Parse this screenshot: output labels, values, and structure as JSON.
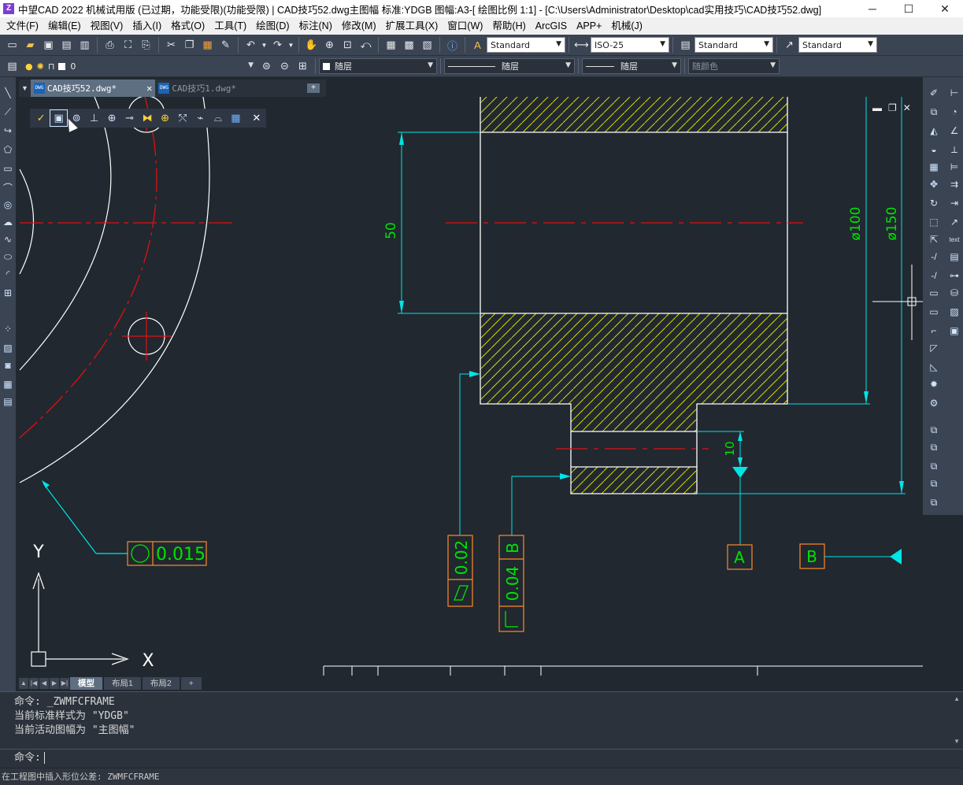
{
  "titlebar": {
    "title": "中望CAD 2022 机械试用版 (已过期，功能受限)(功能受限) | CAD技巧52.dwg主图幅  标准:YDGB  图幅:A3-[ 绘图比例 1:1] - [C:\\Users\\Administrator\\Desktop\\cad实用技巧\\CAD技巧52.dwg]",
    "minimize": "─",
    "maximize": "☐",
    "close": "✕"
  },
  "menubar": {
    "items": [
      "文件(F)",
      "编辑(E)",
      "视图(V)",
      "插入(I)",
      "格式(O)",
      "工具(T)",
      "绘图(D)",
      "标注(N)",
      "修改(M)",
      "扩展工具(X)",
      "窗口(W)",
      "帮助(H)",
      "ArcGIS",
      "APP+",
      "机械(J)"
    ]
  },
  "toolbar1": {
    "text_style": "Standard",
    "dim_style": "ISO-25",
    "table_style": "Standard",
    "mleader_style": "Standard"
  },
  "toolbar2": {
    "layer": "0",
    "color": "随层",
    "linetype": "随层",
    "lineweight": "随层",
    "plotstyle": "随颜色"
  },
  "doctabs": {
    "tabs": [
      {
        "label": "CAD技巧52.dwg*",
        "active": true
      },
      {
        "label": "CAD技巧1.dwg*",
        "active": false
      }
    ],
    "badge": "DWG"
  },
  "layout_tabs": [
    "模型",
    "布局1",
    "布局2",
    "+"
  ],
  "drawing": {
    "dim_50": "50",
    "dim_10": "10",
    "dim_100": "ø100",
    "dim_150": "ø150",
    "datum_a": "A",
    "datum_b": "B",
    "fcf_circularity_value": "0.015",
    "fcf_flatness_value": "0.02",
    "fcf_perp_value": "0.04",
    "fcf_perp_datum": "B",
    "ucs_x": "X",
    "ucs_y": "Y"
  },
  "command": {
    "history": [
      "命令: _ZWMFCFRAME",
      "当前标准样式为 \"YDGB\"",
      "当前活动图幅为 \"主图幅\""
    ],
    "prompt": "命令:"
  },
  "statusbar": {
    "text": "在工程图中插入形位公差:   ZWMFCFRAME"
  },
  "colors": {
    "canvas_bg": "#212830",
    "dim_color": "#00e5e5",
    "text_green": "#00e400",
    "hatch_yellow": "#d7d700",
    "center_red": "#e01010",
    "frame_orange": "#ff8a2a"
  }
}
